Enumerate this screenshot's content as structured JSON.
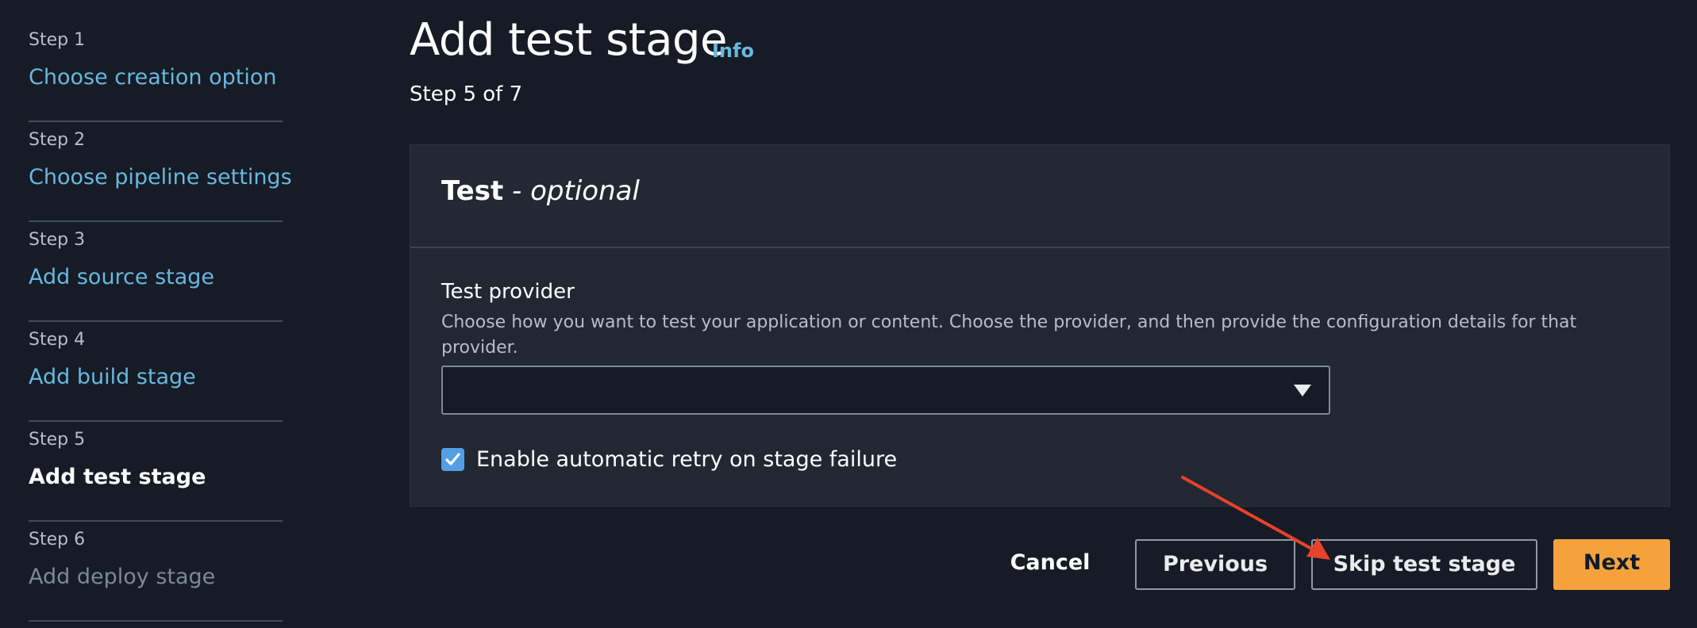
{
  "steps": [
    {
      "label": "Step 1",
      "title": "Choose creation option",
      "state": "link"
    },
    {
      "label": "Step 2",
      "title": "Choose pipeline settings",
      "state": "link"
    },
    {
      "label": "Step 3",
      "title": "Add source stage",
      "state": "link"
    },
    {
      "label": "Step 4",
      "title": "Add build stage",
      "state": "link"
    },
    {
      "label": "Step 5",
      "title": "Add test stage",
      "state": "current"
    },
    {
      "label": "Step 6",
      "title": "Add deploy stage",
      "state": "disabled"
    }
  ],
  "header": {
    "title": "Add test stage",
    "info_label": "Info",
    "step_indicator": "Step 5 of 7"
  },
  "card": {
    "title_main": "Test",
    "title_suffix": " - ",
    "title_optional": "optional",
    "field_label": "Test provider",
    "field_description": "Choose how you want to test your application or content. Choose the provider, and then provide the configuration details for that provider.",
    "select_value": "",
    "checkbox_label": "Enable automatic retry on stage failure",
    "checkbox_checked": true
  },
  "footer": {
    "cancel_label": "Cancel",
    "previous_label": "Previous",
    "skip_label": "Skip test stage",
    "next_label": "Next"
  },
  "colors": {
    "background": "#161b25",
    "link": "#67b8e0",
    "primary_button": "#f5a23d",
    "annotation_arrow": "#e8412c"
  },
  "icons": {
    "select_caret": "caret-down-icon",
    "checkbox": "check-icon",
    "annotation": "red-arrow-icon"
  }
}
